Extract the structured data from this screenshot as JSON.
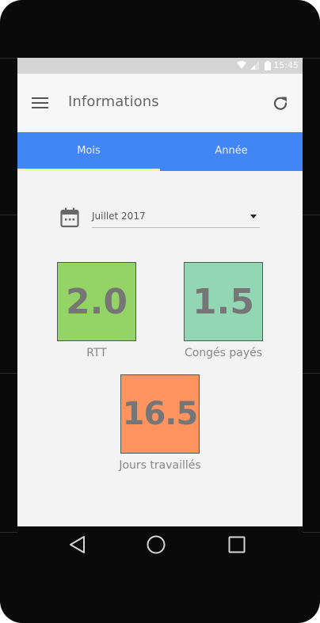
{
  "status_bar": {
    "time": "15:45",
    "icons": [
      "wifi-icon",
      "signal-icon",
      "battery-icon"
    ]
  },
  "app_bar": {
    "title": "Informations",
    "menu_icon": "menu-icon",
    "refresh_icon": "refresh-icon"
  },
  "tabs": [
    {
      "label": "Mois",
      "selected": true
    },
    {
      "label": "Année",
      "selected": false
    }
  ],
  "period": {
    "icon": "calendar-icon",
    "selected": "Juillet 2017"
  },
  "stats": [
    {
      "value": "2.0",
      "label": "RTT",
      "color": "#94d365"
    },
    {
      "value": "1.5",
      "label": "Congés payés",
      "color": "#93d6b3"
    },
    {
      "value": "16.5",
      "label": "Jours travaillés",
      "color": "#fd945f"
    }
  ],
  "colors": {
    "tab_bar": "#4285f4",
    "tab_indicator": "#f2f79c",
    "app_bar": "#f7f7f7",
    "content_bg": "#f3f3f3"
  },
  "nav_bar": {
    "icons": [
      "back-icon",
      "home-icon",
      "recent-apps-icon"
    ]
  }
}
